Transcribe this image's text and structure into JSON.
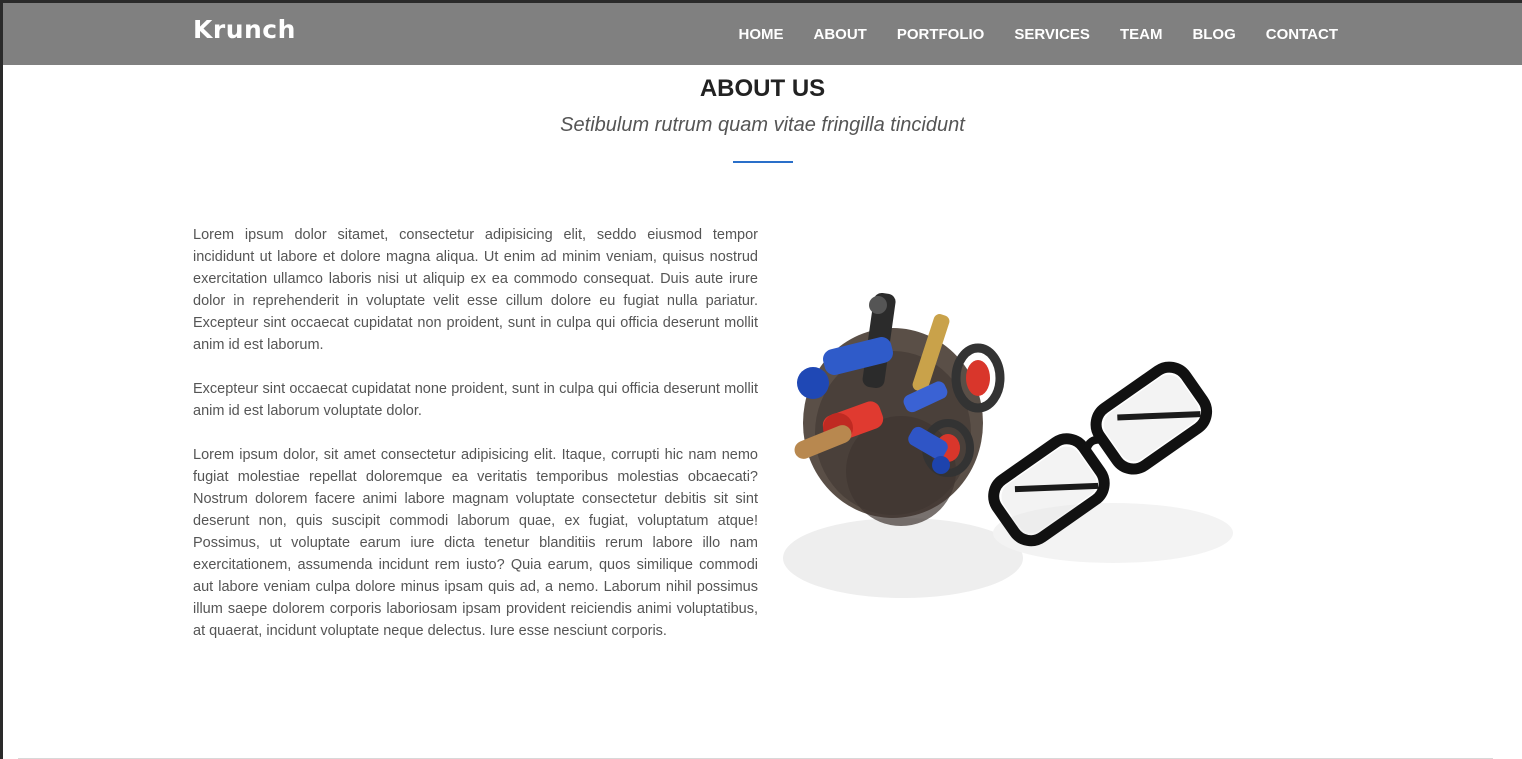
{
  "brand": {
    "logo_text": "Krunch"
  },
  "nav": {
    "items": [
      {
        "label": "HOME"
      },
      {
        "label": "ABOUT"
      },
      {
        "label": "PORTFOLIO"
      },
      {
        "label": "SERVICES"
      },
      {
        "label": "TEAM"
      },
      {
        "label": "BLOG"
      },
      {
        "label": "CONTACT"
      }
    ]
  },
  "about": {
    "title": "ABOUT US",
    "subtitle": "Setibulum rutrum quam vitae fringilla tincidunt",
    "paragraphs": [
      "Lorem ipsum dolor sitamet, consectetur adipisicing elit, seddo eiusmod tempor incididunt ut labore et dolore magna aliqua. Ut enim ad minim veniam, quisus nostrud exercitation ullamco laboris nisi ut aliquip ex ea commodo consequat. Duis aute irure dolor in reprehenderit in voluptate velit esse cillum dolore eu fugiat nulla pariatur. Excepteur sint occaecat cupidatat non proident, sunt in culpa qui officia deserunt mollit anim id est laborum.",
      "Excepteur sint occaecat cupidatat none proident, sunt in culpa qui officia deserunt mollit anim id est laborum voluptate dolor.",
      "Lorem ipsum dolor, sit amet consectetur adipisicing elit. Itaque, corrupti hic nam nemo fugiat molestiae repellat doloremque ea veritatis temporibus molestias obcaecati? Nostrum dolorem facere animi labore magnam voluptate consectetur debitis sit sint deserunt non, quis suscipit commodi laborum quae, ex fugiat, voluptatum atque! Possimus, ut voluptate earum iure dicta tenetur blanditiis rerum labore illo nam exercitationem, assumenda incidunt rem iusto? Quia earum, quos similique commodi aut labore veniam culpa dolore minus ipsam quis ad, a nemo. Laborum nihil possimus illum saepe dolorem corporis laboriosam ipsam provident reiciendis animi voluptatibus, at quaerat, incidunt voluptate neque delectus. Iure esse nesciunt corporis."
    ],
    "image": {
      "alt_icon": "pen-cup-and-glasses-image"
    }
  },
  "colors": {
    "navbar": "#808080",
    "accent_divider": "#2a6fc9",
    "title": "#222222",
    "body_text": "#555555"
  }
}
